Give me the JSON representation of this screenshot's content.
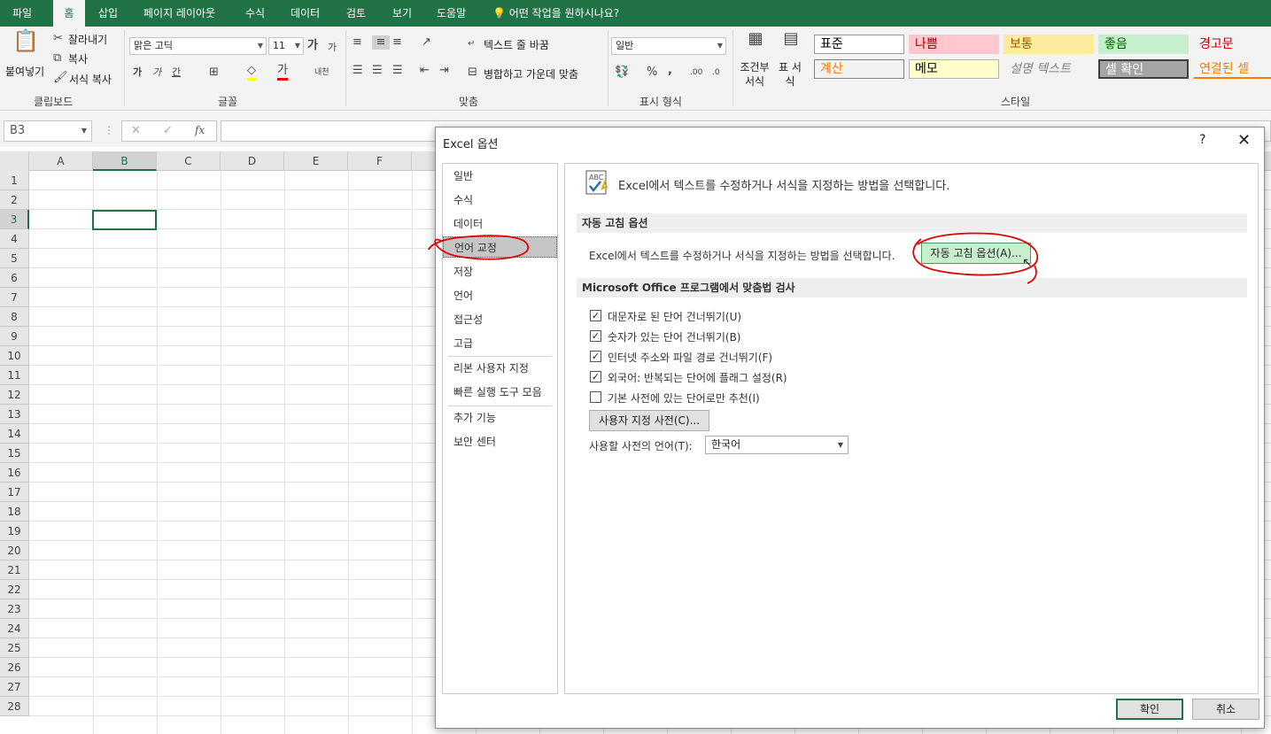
{
  "ribbon_tabs": [
    "파일",
    "홈",
    "삽입",
    "페이지 레이아웃",
    "수식",
    "데이터",
    "검토",
    "보기",
    "도움말"
  ],
  "tell_me": "어떤 작업을 원하시나요?",
  "clipboard": {
    "paste": "붙여넣기",
    "cut": "잘라내기",
    "copy": "복사",
    "format_painter": "서식 복사",
    "label": "클립보드"
  },
  "font": {
    "name": "맑은 고딕",
    "size": "11",
    "label": "글꼴",
    "bold": "가",
    "italic": "가",
    "underline": "간",
    "font_color": "가",
    "phonetic": "내천",
    "grow": "가",
    "shrink": "가"
  },
  "alignment": {
    "wrap": "텍스트 줄 바꿈",
    "merge": "병합하고 가운데 맞춤",
    "label": "맞춤"
  },
  "number": {
    "format": "일반",
    "label": "표시 형식",
    "percent": "%",
    "comma": ","
  },
  "styles": {
    "conditional": "조건부 서식",
    "table": "표 서식",
    "label": "스타일",
    "cells": [
      {
        "text": "표준",
        "bg": "#ffffff",
        "fg": "#000000",
        "border": "#9a9a9a"
      },
      {
        "text": "나쁨",
        "bg": "#ffc7ce",
        "fg": "#9c0006",
        "border": "#ffc7ce"
      },
      {
        "text": "보통",
        "bg": "#ffeb9c",
        "fg": "#9c5700",
        "border": "#ffeb9c"
      },
      {
        "text": "좋음",
        "bg": "#c6efce",
        "fg": "#006100",
        "border": "#c6efce"
      },
      {
        "text": "경고문",
        "bg": "#f3f3f3",
        "fg": "#c00000",
        "border": "#f3f3f3"
      },
      {
        "text": "계산",
        "bg": "#f2f2f2",
        "fg": "#fa7d00",
        "border": "#7f7f7f"
      },
      {
        "text": "메모",
        "bg": "#ffffcc",
        "fg": "#000000",
        "border": "#b2b2b2"
      },
      {
        "text": "설명 텍스트",
        "bg": "#f3f3f3",
        "fg": "#7f7f7f",
        "border": "#f3f3f3"
      },
      {
        "text": "셀 확인",
        "bg": "#a5a5a5",
        "fg": "#ffffff",
        "border": "#3f3f3f"
      },
      {
        "text": "연결된 셀",
        "bg": "#f3f3f3",
        "fg": "#fa7d00",
        "border": "#f3f3f3"
      }
    ]
  },
  "formula_bar": {
    "name_box": "B3",
    "fx": "fx"
  },
  "columns": [
    "A",
    "B",
    "C",
    "D",
    "E",
    "F"
  ],
  "rows": [
    "1",
    "2",
    "3",
    "4",
    "5",
    "6",
    "7",
    "8",
    "9",
    "10",
    "11",
    "12",
    "13",
    "14",
    "15",
    "16",
    "17",
    "18",
    "19",
    "20",
    "21",
    "22",
    "23",
    "24",
    "25",
    "26",
    "27",
    "28"
  ],
  "dialog": {
    "title": "Excel 옵션",
    "help": "?",
    "close": "✕",
    "nav": [
      "일반",
      "수식",
      "데이터",
      "언어 교정",
      "저장",
      "언어",
      "접근성",
      "고급",
      "리본 사용자 지정",
      "빠른 실행 도구 모음",
      "추가 기능",
      "보안 센터"
    ],
    "selected_nav": "언어 교정",
    "header": "Excel에서 텍스트를 수정하거나 서식을 지정하는 방법을 선택합니다.",
    "autocorrect_section": "자동 고침 옵션",
    "autocorrect_desc": "Excel에서 텍스트를 수정하거나 서식을 지정하는 방법을 선택합니다.",
    "autocorrect_button": "자동 고침 옵션(A)...",
    "spelling_section": "Microsoft Office 프로그램에서 맞춤법 검사",
    "checks": [
      {
        "label": "대문자로 된 단어 건너뛰기(U)",
        "checked": true
      },
      {
        "label": "숫자가 있는 단어 건너뛰기(B)",
        "checked": true
      },
      {
        "label": "인터넷 주소와 파일 경로 건너뛰기(F)",
        "checked": true
      },
      {
        "label": "외국어: 반복되는 단어에 플래그 설정(R)",
        "checked": true
      },
      {
        "label": "기본 사전에 있는 단어로만 추천(I)",
        "checked": false
      }
    ],
    "custom_dict_button": "사용자 지정 사전(C)...",
    "dict_lang_label": "사용할 사전의 언어(T):",
    "dict_lang_value": "한국어",
    "ok": "확인",
    "cancel": "취소"
  },
  "annotation_color": "#e00000",
  "accent": "#217346"
}
